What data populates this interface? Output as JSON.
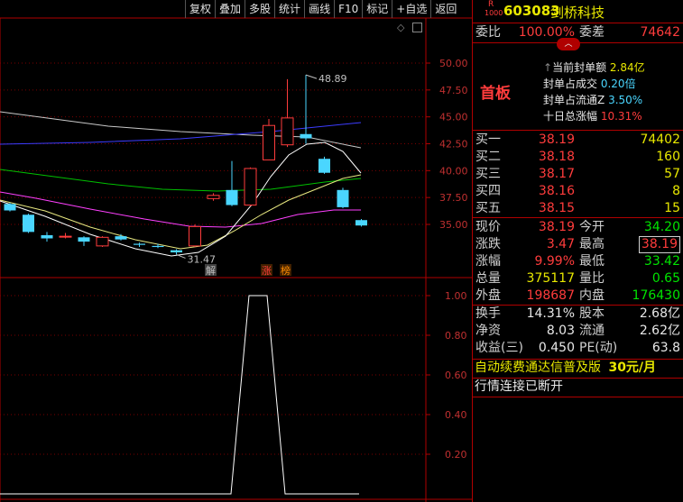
{
  "toolbar": [
    "复权",
    "叠加",
    "多股",
    "统计",
    "画线",
    "F10",
    "标记",
    "+自选",
    "返回"
  ],
  "stock": {
    "code": "603083",
    "name": "剑桥科技",
    "badge_r": "R",
    "badge_num": "1000"
  },
  "weibi": {
    "label": "委比",
    "value": "100.00%",
    "label2": "委差",
    "value2": "74642"
  },
  "shouban": {
    "title": "首板",
    "items": [
      {
        "label": "当前封单额",
        "value": "2.84亿"
      },
      {
        "label": "封单占成交",
        "value": "0.20倍"
      },
      {
        "label": "封单占流通Z",
        "value": "3.50%"
      },
      {
        "label": "十日总涨幅",
        "value": "10.31%"
      }
    ]
  },
  "buy": [
    {
      "label": "买一",
      "price": "38.19",
      "vol": "74402"
    },
    {
      "label": "买二",
      "price": "38.18",
      "vol": "160"
    },
    {
      "label": "买三",
      "price": "38.17",
      "vol": "57"
    },
    {
      "label": "买四",
      "price": "38.16",
      "vol": "8"
    },
    {
      "label": "买五",
      "price": "38.15",
      "vol": "15"
    }
  ],
  "quote": [
    {
      "l1": "现价",
      "v1": "38.19",
      "l2": "今开",
      "v2": "34.20"
    },
    {
      "l1": "涨跌",
      "v1": "3.47",
      "l2": "最高",
      "v2": "38.19"
    },
    {
      "l1": "涨幅",
      "v1": "9.99%",
      "l2": "最低",
      "v2": "33.42"
    },
    {
      "l1": "总量",
      "v1": "375117",
      "l2": "量比",
      "v2": "0.65"
    },
    {
      "l1": "外盘",
      "v1": "198687",
      "l2": "内盘",
      "v2": "176430"
    }
  ],
  "fund": [
    {
      "l1": "换手",
      "v1": "14.31%",
      "l2": "股本",
      "v2": "2.68亿"
    },
    {
      "l1": "净资",
      "v1": "8.03",
      "l2": "流通",
      "v2": "2.62亿"
    },
    {
      "l1": "收益(三)",
      "v1": "0.450",
      "l2": "PE(动)",
      "v2": "63.8"
    }
  ],
  "ad": {
    "text": "自动续费通达信普及版",
    "price": "30元/月"
  },
  "status": "行情连接已断开",
  "chart_data": {
    "type": "candlestick",
    "y_ticks": [
      "50.00",
      "47.50",
      "45.00",
      "42.50",
      "40.00",
      "37.50",
      "35.00"
    ],
    "ind_ticks": [
      "1.00",
      "0.80",
      "0.60",
      "0.40",
      "0.20"
    ],
    "annotations": {
      "high": "48.89",
      "low": "31.47",
      "markers": [
        "解",
        "涨",
        "榜"
      ]
    },
    "candles": [
      {
        "o": 36.9,
        "c": 36.3,
        "h": 37.0,
        "l": 36.2
      },
      {
        "o": 35.9,
        "c": 34.3,
        "h": 36.0,
        "l": 34.2
      },
      {
        "o": 34.0,
        "c": 33.7,
        "h": 34.3,
        "l": 33.4
      },
      {
        "o": 33.9,
        "c": 33.9,
        "h": 34.2,
        "l": 33.7
      },
      {
        "o": 33.8,
        "c": 33.4,
        "h": 33.9,
        "l": 33.0
      },
      {
        "o": 33.0,
        "c": 33.8,
        "h": 33.9,
        "l": 32.9
      },
      {
        "o": 33.9,
        "c": 33.6,
        "h": 34.1,
        "l": 33.5
      },
      {
        "o": 33.2,
        "c": 33.1,
        "h": 33.3,
        "l": 32.9
      },
      {
        "o": 33.0,
        "c": 32.9,
        "h": 33.2,
        "l": 32.8
      },
      {
        "o": 32.6,
        "c": 32.4,
        "h": 32.7,
        "l": 32.2
      },
      {
        "o": 33.0,
        "c": 34.8,
        "h": 35.0,
        "l": 32.9
      },
      {
        "o": 37.4,
        "c": 37.7,
        "h": 37.9,
        "l": 37.2
      },
      {
        "o": 38.2,
        "c": 36.8,
        "h": 40.9,
        "l": 36.7
      },
      {
        "o": 36.8,
        "c": 40.2,
        "h": 40.3,
        "l": 36.7
      },
      {
        "o": 41.0,
        "c": 44.2,
        "h": 44.8,
        "l": 41.0
      },
      {
        "o": 42.4,
        "c": 44.9,
        "h": 48.5,
        "l": 42.2
      },
      {
        "o": 43.4,
        "c": 43.0,
        "h": 48.9,
        "l": 42.5
      },
      {
        "o": 41.1,
        "c": 39.8,
        "h": 41.3,
        "l": 39.7
      },
      {
        "o": 38.2,
        "c": 36.6,
        "h": 38.4,
        "l": 36.5
      },
      {
        "o": 35.4,
        "c": 34.9,
        "h": 35.5,
        "l": 34.8
      }
    ]
  }
}
